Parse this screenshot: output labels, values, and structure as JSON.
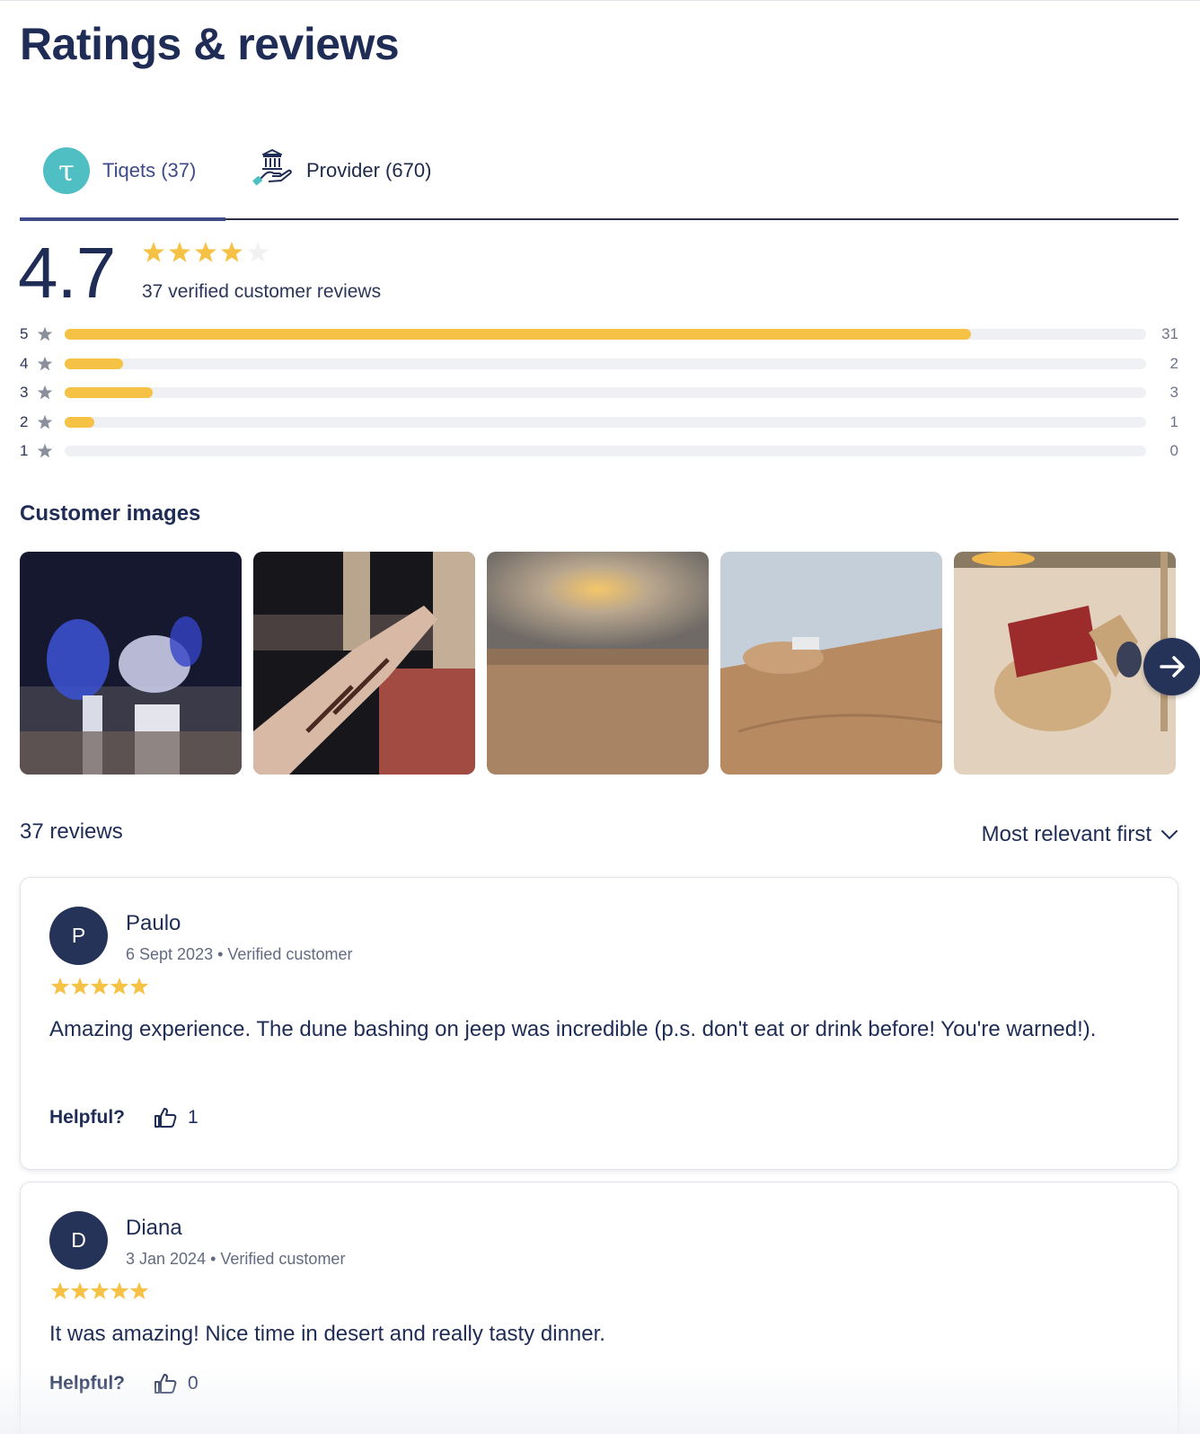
{
  "page": {
    "title": "Ratings & reviews"
  },
  "tabs": [
    {
      "label": "Tiqets (37)",
      "logo_letter": "τ",
      "active": true,
      "logo_color": "#4fbfc4"
    },
    {
      "label": "Provider (670)",
      "icon": "provider-hand-building-icon",
      "active": false
    }
  ],
  "summary": {
    "rating": "4.7",
    "rating_value": 4.7,
    "reviews_text": "37 verified customer reviews",
    "star_color": "#f6c246"
  },
  "distribution": [
    {
      "stars": "5",
      "count": "31",
      "fraction": 0.838
    },
    {
      "stars": "4",
      "count": "2",
      "fraction": 0.054
    },
    {
      "stars": "3",
      "count": "3",
      "fraction": 0.081
    },
    {
      "stars": "2",
      "count": "1",
      "fraction": 0.027
    },
    {
      "stars": "1",
      "count": "0",
      "fraction": 0
    }
  ],
  "images": {
    "title": "Customer images",
    "items": [
      "dancers-at-night",
      "henna-hand",
      "desert-sunset",
      "dune-bashing-jeep",
      "resting-camel"
    ]
  },
  "reviews": {
    "count_label": "37 reviews",
    "sort_label": "Most relevant first",
    "items": [
      {
        "initial": "P",
        "name": "Paulo",
        "meta": "6 Sept 2023 • Verified customer",
        "stars": 5,
        "text": "Amazing experience. The dune bashing on jeep was incredible (p.s. don't eat or drink before! You're warned!).",
        "helpful_label": "Helpful?",
        "helpful_count": "1"
      },
      {
        "initial": "D",
        "name": "Diana",
        "meta": "3 Jan 2024 • Verified customer",
        "stars": 5,
        "text": "It was amazing! Nice time in desert and really tasty dinner.",
        "helpful_label": "Helpful?",
        "helpful_count": "0"
      }
    ]
  }
}
